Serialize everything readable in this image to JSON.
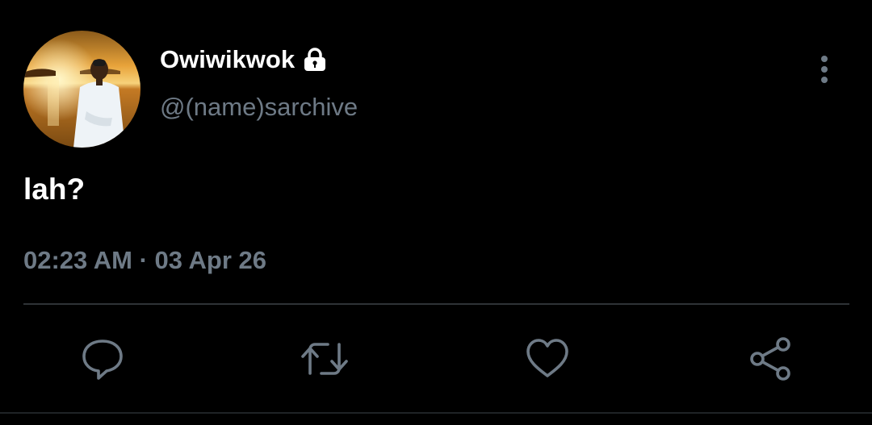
{
  "tweet": {
    "display_name": "Owiwikwok",
    "handle": "@(name)sarchive",
    "text": "lah?",
    "time": "02:23 AM",
    "separator": "·",
    "date": "03 Apr 26",
    "is_protected": true
  },
  "icons": {
    "avatar": "avatar",
    "protected": "lock-icon",
    "more": "more-vertical-icon",
    "reply": "reply-icon",
    "retweet": "retweet-icon",
    "like": "heart-icon",
    "share": "share-icon"
  },
  "colors": {
    "background": "#000000",
    "primary_text": "#ffffff",
    "secondary_text": "#6e7a86",
    "divider": "#2f3336",
    "icon": "#6e7a86"
  }
}
